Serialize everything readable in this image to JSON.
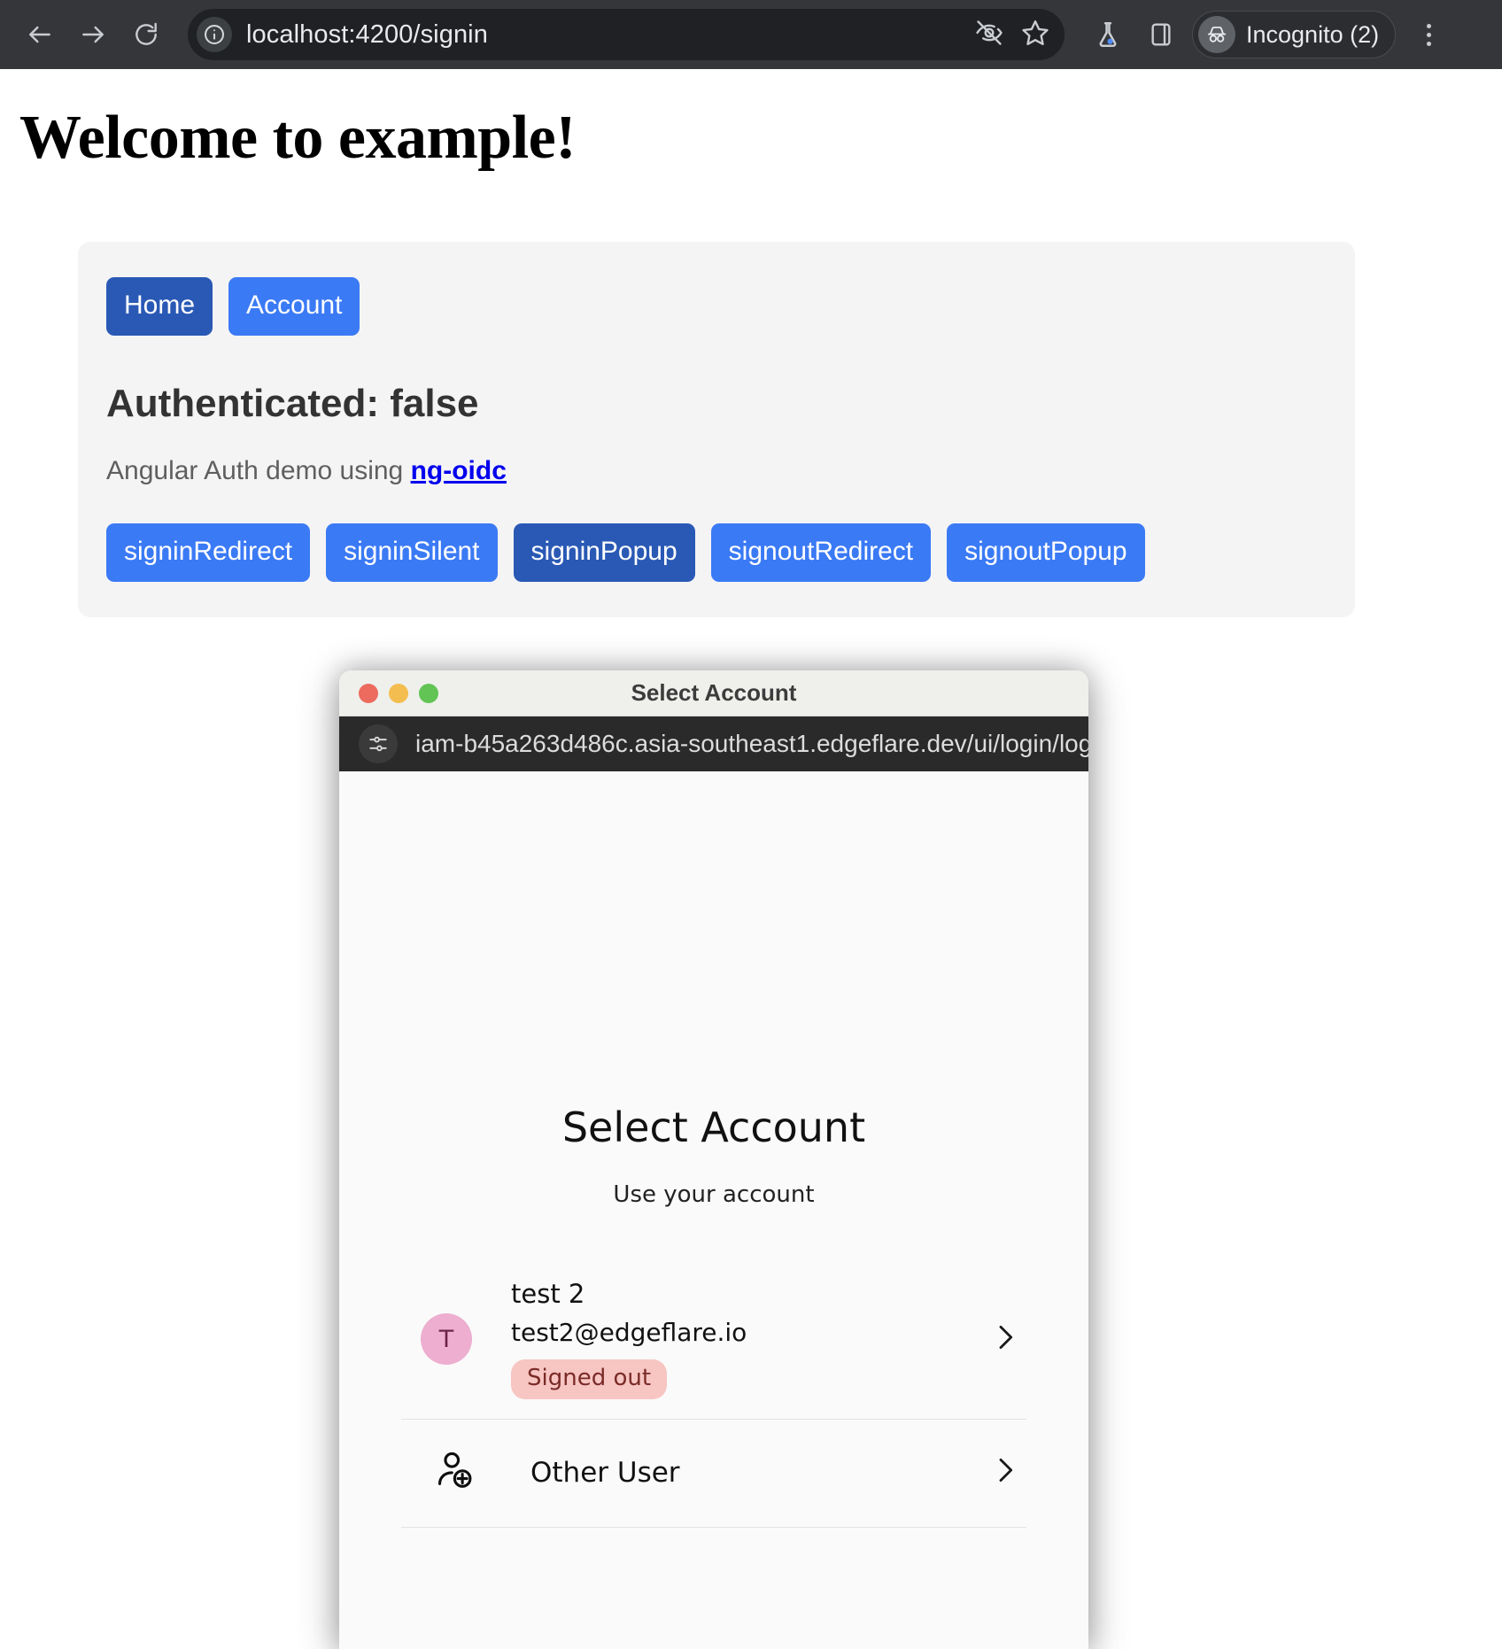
{
  "browser": {
    "back_icon": "arrow-left-icon",
    "forward_icon": "arrow-right-icon",
    "reload_icon": "reload-icon",
    "site_info_icon": "site-info-icon",
    "url": "localhost:4200/signin",
    "tracking_protection_icon": "eye-slash-icon",
    "bookmark_icon": "star-icon",
    "extension_icon": "flask-icon",
    "sidepanel_icon": "side-panel-icon",
    "incognito_label": "Incognito (2)",
    "incognito_avatar_icon": "incognito-hat-icon",
    "menu_icon": "kebab-menu-icon"
  },
  "page": {
    "title": "Welcome to example!",
    "nav": [
      {
        "label": "Home",
        "style": "primary"
      },
      {
        "label": "Account",
        "style": "accent"
      }
    ],
    "auth_status": "Authenticated: false",
    "demo_text_prefix": "Angular Auth demo using ",
    "demo_link_label": "ng-oidc",
    "actions": [
      {
        "label": "signinRedirect",
        "style": "accent"
      },
      {
        "label": "signinSilent",
        "style": "accent"
      },
      {
        "label": "signinPopup",
        "style": "primary"
      },
      {
        "label": "signoutRedirect",
        "style": "accent"
      },
      {
        "label": "signoutPopup",
        "style": "accent"
      }
    ]
  },
  "popup": {
    "window_title": "Select Account",
    "traffic_lights": [
      "close",
      "minimize",
      "maximize"
    ],
    "url_icon": "permissions-icon",
    "url": "iam-b45a263d486c.asia-southeast1.edgeflare.dev/ui/login/log…",
    "heading": "Select Account",
    "subheading": "Use your account",
    "accounts": [
      {
        "initial": "T",
        "name": "test 2",
        "email": "test2@edgeflare.io",
        "status": "Signed out",
        "chevron_icon": "chevron-right-icon"
      }
    ],
    "other_user": {
      "icon": "person-add-icon",
      "label": "Other User",
      "chevron_icon": "chevron-right-icon"
    }
  },
  "colors": {
    "primary_blue": "#2a59b5",
    "accent_blue": "#3b7af5",
    "link_blue": "#0000ee",
    "avatar_pink": "#edaed0",
    "badge_pink": "#f7c5c2",
    "chrome_dark": "#35363a",
    "omnibox_dark": "#202124",
    "popup_url_dark": "#2a2a2a"
  }
}
